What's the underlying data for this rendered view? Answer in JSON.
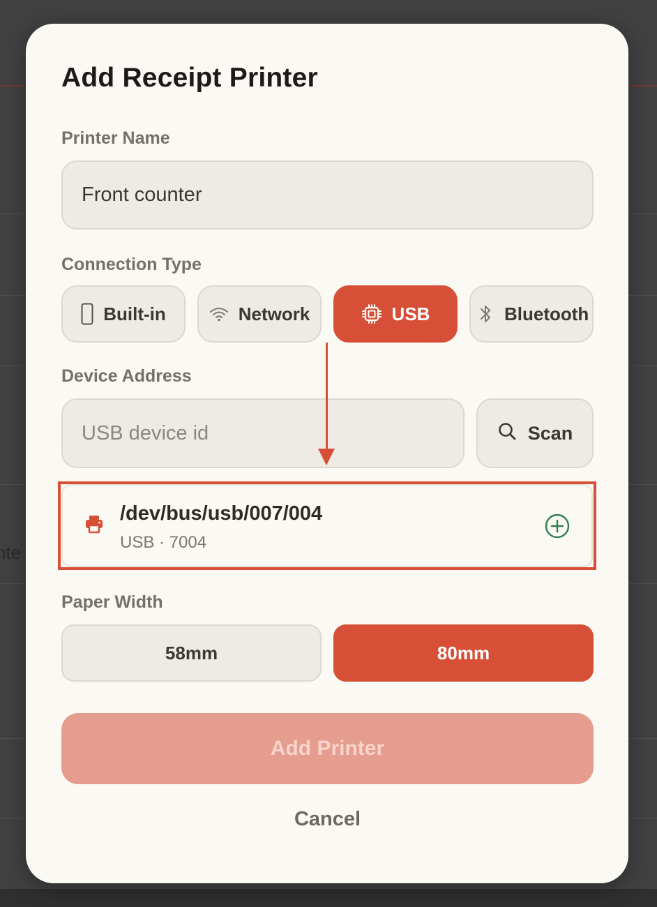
{
  "background": {
    "partial_text": "nte"
  },
  "dialog": {
    "title": "Add Receipt Printer",
    "printer_name": {
      "label": "Printer Name",
      "value": "Front counter"
    },
    "connection_type": {
      "label": "Connection Type",
      "options": [
        {
          "label": "Built-in",
          "icon": "phone-icon",
          "selected": false
        },
        {
          "label": "Network",
          "icon": "wifi-icon",
          "selected": false
        },
        {
          "label": "USB",
          "icon": "chip-icon",
          "selected": true
        },
        {
          "label": "Bluetooth",
          "icon": "bluetooth-icon",
          "selected": false
        }
      ]
    },
    "device_address": {
      "label": "Device Address",
      "placeholder": "USB device id",
      "scan_label": "Scan"
    },
    "found_device": {
      "path": "/dev/bus/usb/007/004",
      "detail": "USB · 7004"
    },
    "paper_width": {
      "label": "Paper Width",
      "options": [
        {
          "label": "58mm",
          "selected": false
        },
        {
          "label": "80mm",
          "selected": true
        }
      ]
    },
    "add_button": "Add Printer",
    "cancel_button": "Cancel"
  },
  "colors": {
    "accent": "#d84f37",
    "success": "#2f7d4f",
    "overlay": "#414141"
  }
}
